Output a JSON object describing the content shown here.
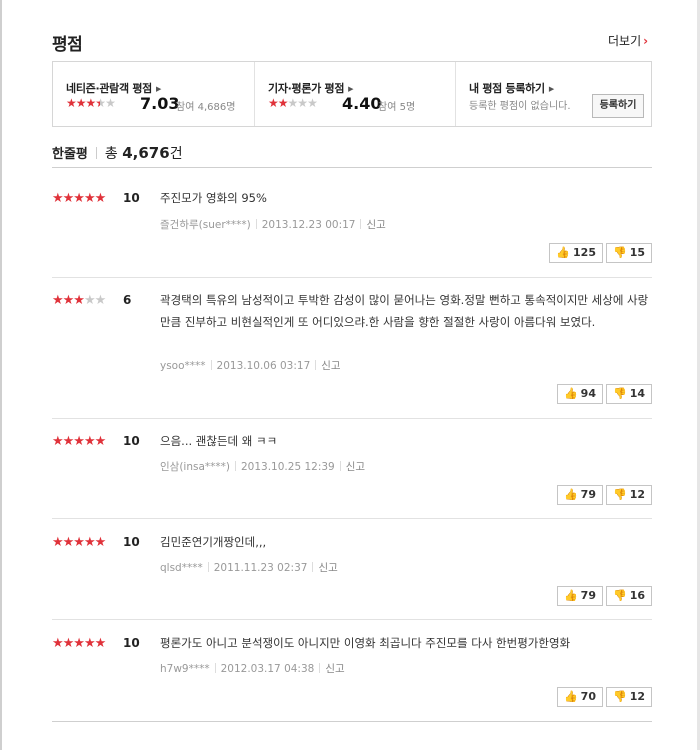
{
  "header": {
    "title": "평점",
    "more_label": "더보기"
  },
  "summary": {
    "netizen": {
      "label": "네티즌·관람객 평점",
      "score": "7.03",
      "participants": "참여 4,686명",
      "stars": 3.5
    },
    "critic": {
      "label": "기자·평론가 평점",
      "score": "4.40",
      "participants": "참여 5명",
      "stars": 2
    },
    "mine": {
      "label": "내 평점 등록하기",
      "description": "등록한 평점이 없습니다.",
      "button_label": "등록하기"
    }
  },
  "reviews_header": {
    "label": "한줄평",
    "total_prefix": "총",
    "total_count": "4,676",
    "total_suffix": "건"
  },
  "colors": {
    "accent": "#e0323a",
    "star_off": "#c9c9c9"
  },
  "icons": {
    "like": "thumbs-up-icon",
    "dislike": "thumbs-down-icon",
    "more": "chevron-right-icon",
    "label_arrow": "triangle-right-icon"
  },
  "reviews": [
    {
      "stars": 5,
      "score": "10",
      "text": "주진모가 영화의 95%",
      "author": "즐건하루(suer****)",
      "date": "2013.12.23 00:17",
      "report": "신고",
      "likes": "125",
      "dislikes": "15"
    },
    {
      "stars": 3,
      "score": "6",
      "text": "곽경택의 특유의 남성적이고 투박한 감성이 많이 묻어나는 영화.정말 뻔하고 통속적이지만 세상에 사랑만큼 진부하고 비현실적인게 또 어디있으랴.한 사람을 향한 절절한 사랑이 아름다워 보였다.",
      "author": "ysoo****",
      "date": "2013.10.06 03:17",
      "report": "신고",
      "likes": "94",
      "dislikes": "14"
    },
    {
      "stars": 5,
      "score": "10",
      "text": "으음... 괜찮든데 왜 ㅋㅋ",
      "author": "인삼(insa****)",
      "date": "2013.10.25 12:39",
      "report": "신고",
      "likes": "79",
      "dislikes": "12"
    },
    {
      "stars": 5,
      "score": "10",
      "text": "김민준연기개짱인데,,,",
      "author": "qlsd****",
      "date": "2011.11.23 02:37",
      "report": "신고",
      "likes": "79",
      "dislikes": "16"
    },
    {
      "stars": 5,
      "score": "10",
      "text": "평론가도 아니고 분석쟁이도 아니지만 이영화 최곱니다 주진모를 다사 한번평가한영화",
      "author": "h7w9****",
      "date": "2012.03.17 04:38",
      "report": "신고",
      "likes": "70",
      "dislikes": "12"
    }
  ]
}
